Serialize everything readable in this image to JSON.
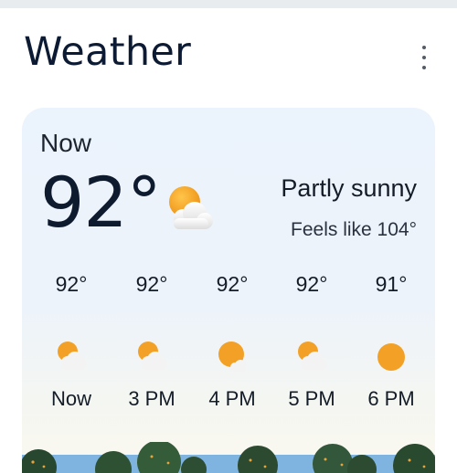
{
  "header": {
    "title": "Weather"
  },
  "current": {
    "label": "Now",
    "temperature": "92°",
    "condition": "Partly sunny",
    "feels_like": "Feels like 104°",
    "icon": "partly-sunny-icon"
  },
  "hourly": [
    {
      "temp": "92°",
      "time": "Now",
      "icon": "partly-sunny-icon"
    },
    {
      "temp": "92°",
      "time": "3 PM",
      "icon": "partly-sunny-icon"
    },
    {
      "temp": "92°",
      "time": "4 PM",
      "icon": "mostly-sunny-icon"
    },
    {
      "temp": "92°",
      "time": "5 PM",
      "icon": "partly-sunny-icon"
    },
    {
      "temp": "91°",
      "time": "6 PM",
      "icon": "sunny-icon"
    }
  ],
  "colors": {
    "sun": "#f2a126",
    "cloud": "#f4f4f4",
    "text": "#0e1a2e",
    "card": "#ebf3fc"
  }
}
